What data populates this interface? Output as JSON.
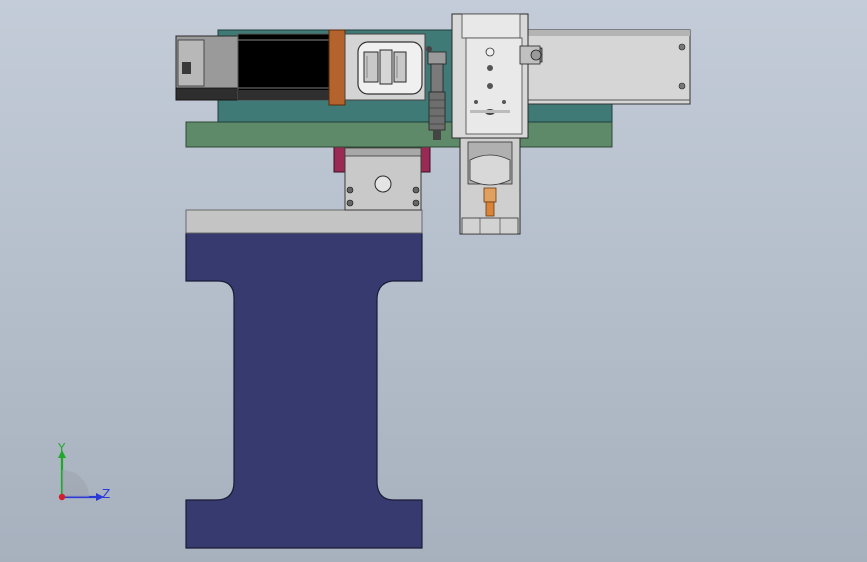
{
  "viewport": {
    "background_top": "#c3ccd8",
    "background_bottom": "#a7b1be"
  },
  "model": {
    "colors": {
      "base_frame": "#363a6e",
      "base_top_plate": "#c4c4c4",
      "mounting_plate": "#5f8a6a",
      "teal_body": "#3f7a76",
      "slide_grey": "#d8d8d8",
      "dark_grey": "#5c5c5c",
      "copper_block": "#b5632c",
      "magenta_clamp": "#9a2a54",
      "cutter_orange": "#d9843a"
    }
  },
  "triad": {
    "x_label": "",
    "y_label": "Y",
    "z_label": "Z",
    "x_color": "#d0202a",
    "y_color": "#1fa82a",
    "z_color": "#2a38d8"
  }
}
